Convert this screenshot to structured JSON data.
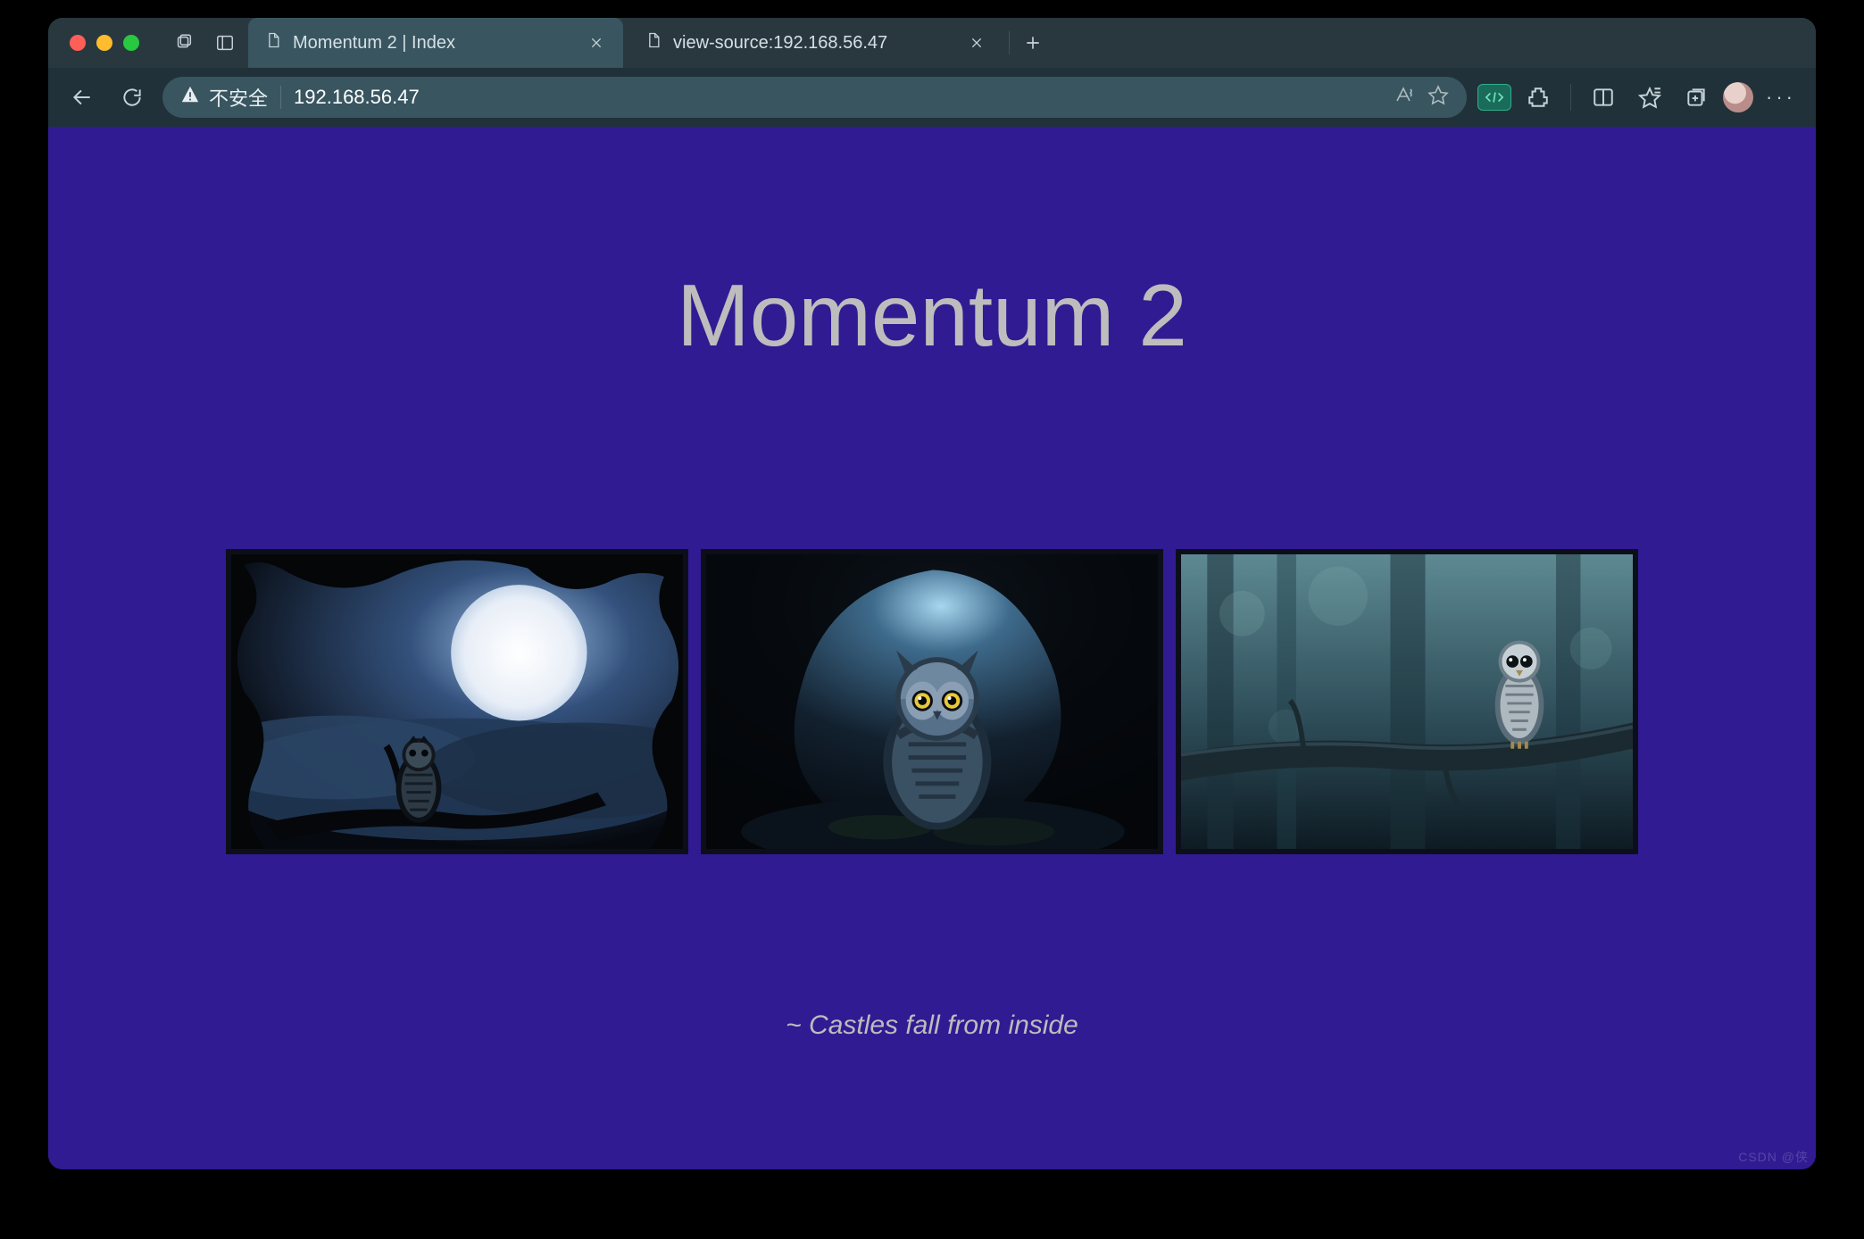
{
  "browser": {
    "tabs": [
      {
        "title": "Momentum 2 | Index",
        "active": true
      },
      {
        "title": "view-source:192.168.56.47",
        "active": false
      }
    ],
    "address": {
      "security_label": "不安全",
      "url": "192.168.56.47"
    }
  },
  "page": {
    "title": "Momentum 2",
    "images": [
      {
        "name": "owl-moon",
        "alt": "Owl silhouetted against full moon"
      },
      {
        "name": "owl-cave",
        "alt": "Owl in a dark cave"
      },
      {
        "name": "owl-branch",
        "alt": "Owl perched on a forest branch"
      }
    ],
    "tagline": "~ Castles fall from inside",
    "watermark": "CSDN @侠"
  },
  "colors": {
    "page_bg": "#311B92",
    "text": "#bdbdbd",
    "browser_chrome": "#203139",
    "tab_active": "#385560"
  }
}
